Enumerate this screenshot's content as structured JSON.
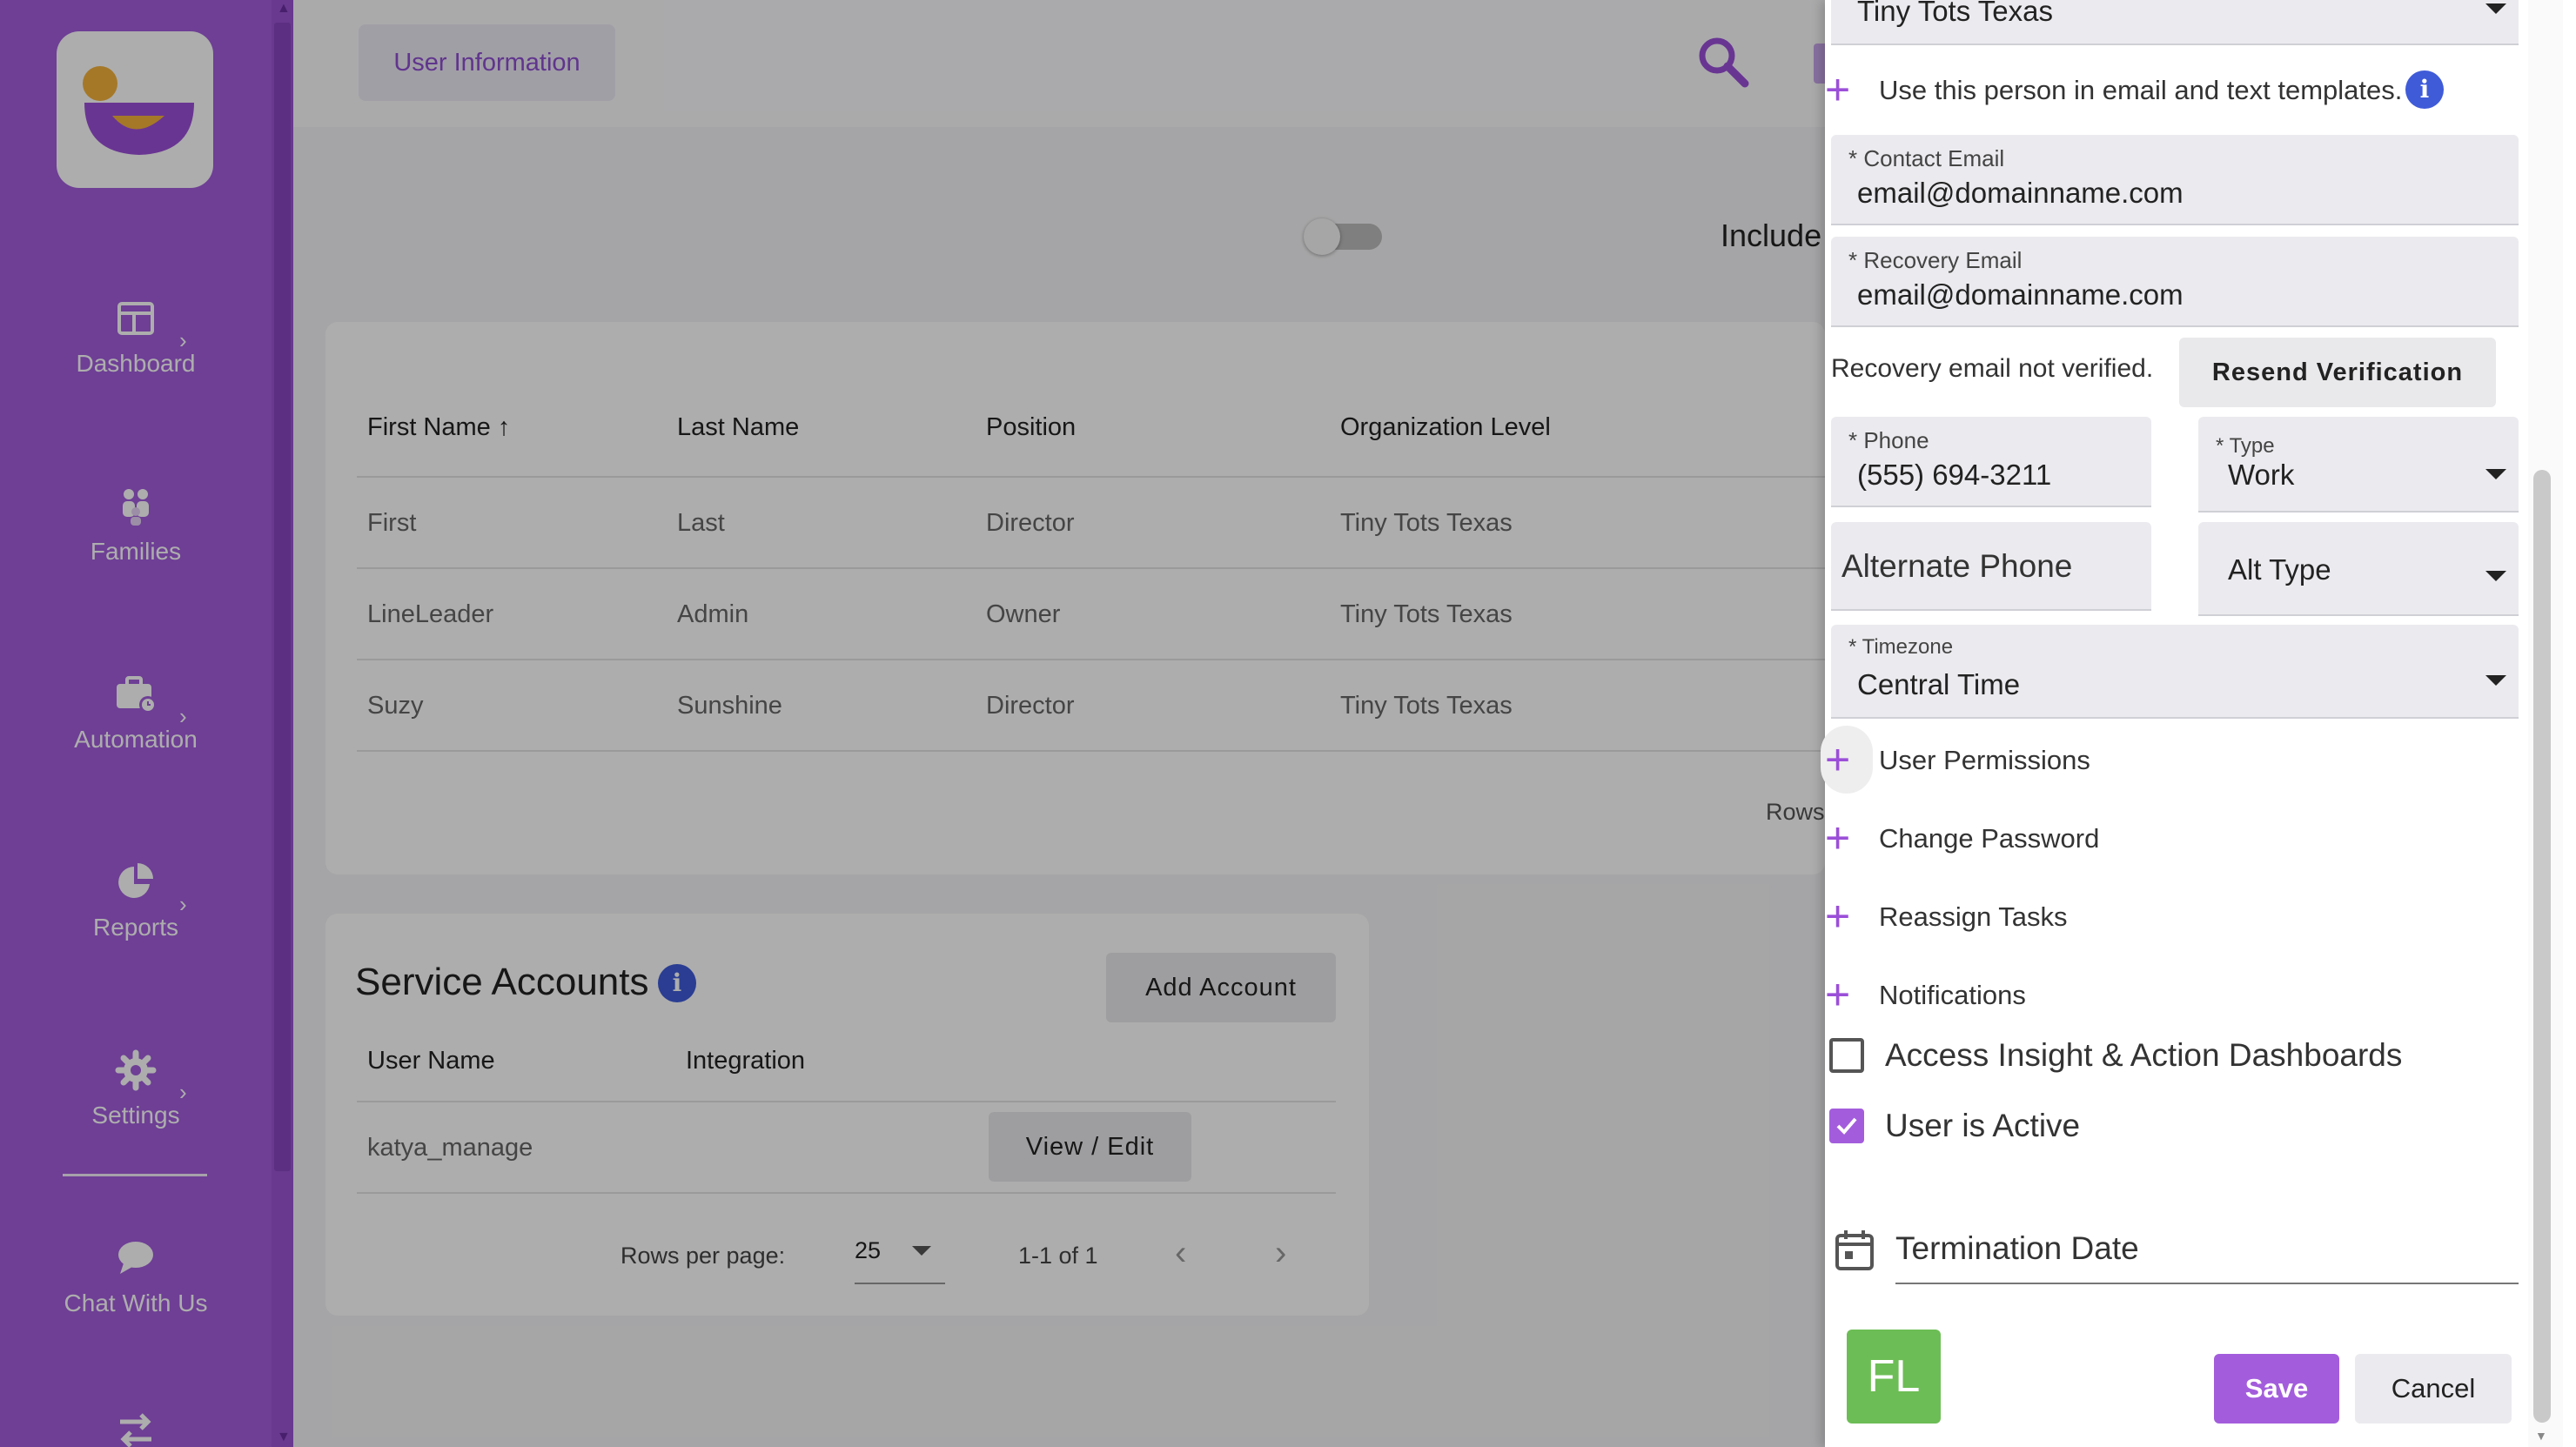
{
  "sidebar": {
    "items": [
      {
        "label": "Dashboard",
        "icon": "dashboard-icon"
      },
      {
        "label": "Families",
        "icon": "families-icon"
      },
      {
        "label": "Automation",
        "icon": "automation-icon"
      },
      {
        "label": "Reports",
        "icon": "reports-icon"
      },
      {
        "label": "Settings",
        "icon": "settings-icon"
      },
      {
        "label": "Chat With Us",
        "icon": "chat-icon"
      }
    ]
  },
  "header": {
    "tab_label": "User Information",
    "include_label": "Include"
  },
  "users_table": {
    "columns": [
      "First Name",
      "Last Name",
      "Position",
      "Organization Level"
    ],
    "rows": [
      [
        "First",
        "Last",
        "Director",
        "Tiny Tots Texas"
      ],
      [
        "LineLeader",
        "Admin",
        "Owner",
        "Tiny Tots Texas"
      ],
      [
        "Suzy",
        "Sunshine",
        "Director",
        "Tiny Tots Texas"
      ]
    ],
    "rows_label": "Rows"
  },
  "service_accounts": {
    "title": "Service Accounts",
    "add_label": "Add Account",
    "columns": [
      "User Name",
      "Integration"
    ],
    "rows": [
      {
        "user": "katya_manage",
        "integration": "",
        "action": "View / Edit"
      }
    ],
    "rows_per_page_label": "Rows per page:",
    "rows_per_page": "25",
    "range": "1-1 of 1"
  },
  "drawer": {
    "org_value": "Tiny Tots Texas",
    "use_person_label": "Use this person in email and text templates.",
    "contact_email": {
      "label": "* Contact Email",
      "value": "email@domainname.com"
    },
    "recovery_email": {
      "label": "* Recovery Email",
      "value": "email@domainname.com"
    },
    "recovery_status": "Recovery email not verified.",
    "resend_label": "Resend Verification",
    "phone": {
      "label": "* Phone",
      "value": "(555) 694-3211"
    },
    "type": {
      "label": "* Type",
      "value": "Work"
    },
    "alt_phone_placeholder": "Alternate Phone",
    "alt_type_placeholder": "Alt Type",
    "timezone": {
      "label": "* Timezone",
      "value": "Central Time"
    },
    "sections": [
      "User Permissions",
      "Change Password",
      "Reassign Tasks",
      "Notifications"
    ],
    "access_dashboards_label": "Access Insight & Action Dashboards",
    "access_dashboards_checked": false,
    "user_active_label": "User is Active",
    "user_active_checked": true,
    "termination_placeholder": "Termination Date",
    "avatar_initials": "FL",
    "save_label": "Save",
    "cancel_label": "Cancel"
  },
  "colors": {
    "brand_purple": "#a35ddc",
    "info_blue": "#3f5bd8",
    "avatar_green": "#6cbd55"
  }
}
